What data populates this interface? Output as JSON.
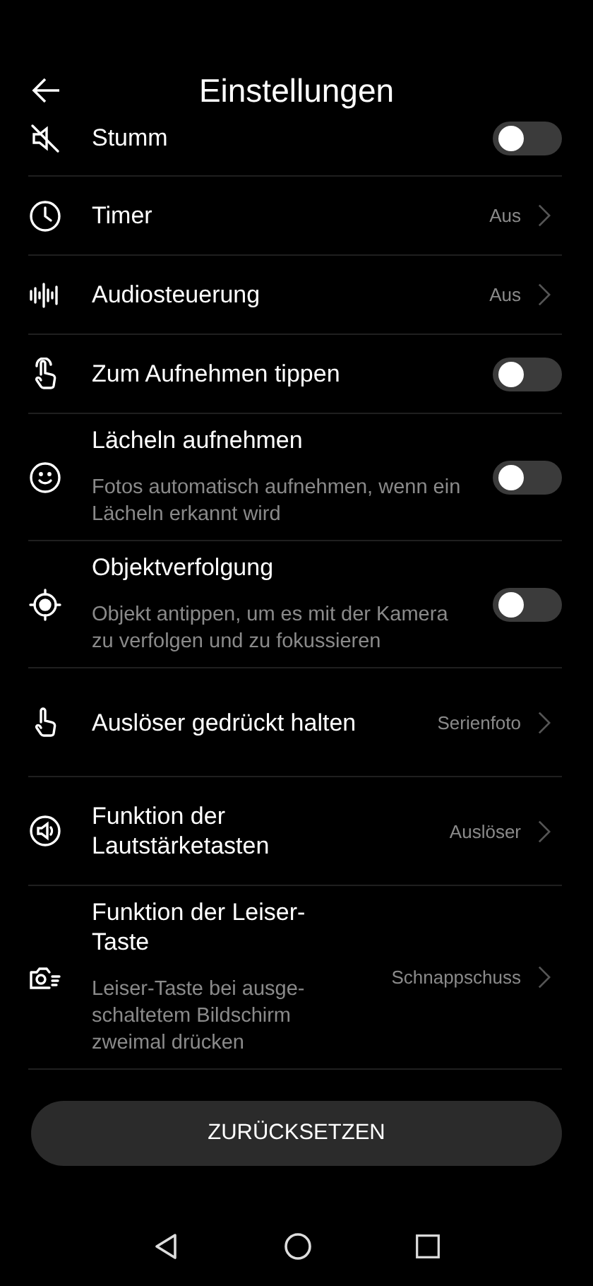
{
  "header": {
    "title": "Einstellungen"
  },
  "rows": [
    {
      "kind": "toggle",
      "title": "Stumm",
      "on": false
    },
    {
      "kind": "link",
      "title": "Timer",
      "value": "Aus"
    },
    {
      "kind": "link",
      "title": "Audiosteuerung",
      "value": "Aus"
    },
    {
      "kind": "toggle",
      "title": "Zum Aufnehmen tippen",
      "on": false
    },
    {
      "kind": "toggle",
      "title": "Lächeln aufnehmen",
      "subtitle": "Fotos automatisch aufnehmen, wenn ein Lächeln erkannt wird",
      "on": false
    },
    {
      "kind": "toggle",
      "title": "Objektverfolgung",
      "subtitle": "Objekt antippen, um es mit der Kamera zu verfolgen und zu fokussieren",
      "on": false
    },
    {
      "kind": "link",
      "title": "Auslöser gedrückt halten",
      "value": "Serienfoto"
    },
    {
      "kind": "link",
      "title": "Funktion der Lautstärketasten",
      "value": "Auslöser"
    },
    {
      "kind": "link",
      "title": "Funktion der Leiser-Taste",
      "subtitle": "Leiser-Taste bei ausge-schaltetem Bildschirm zweimal drücken",
      "value": "Schnappschuss"
    }
  ],
  "reset_button": "ZURÜCKSETZEN"
}
